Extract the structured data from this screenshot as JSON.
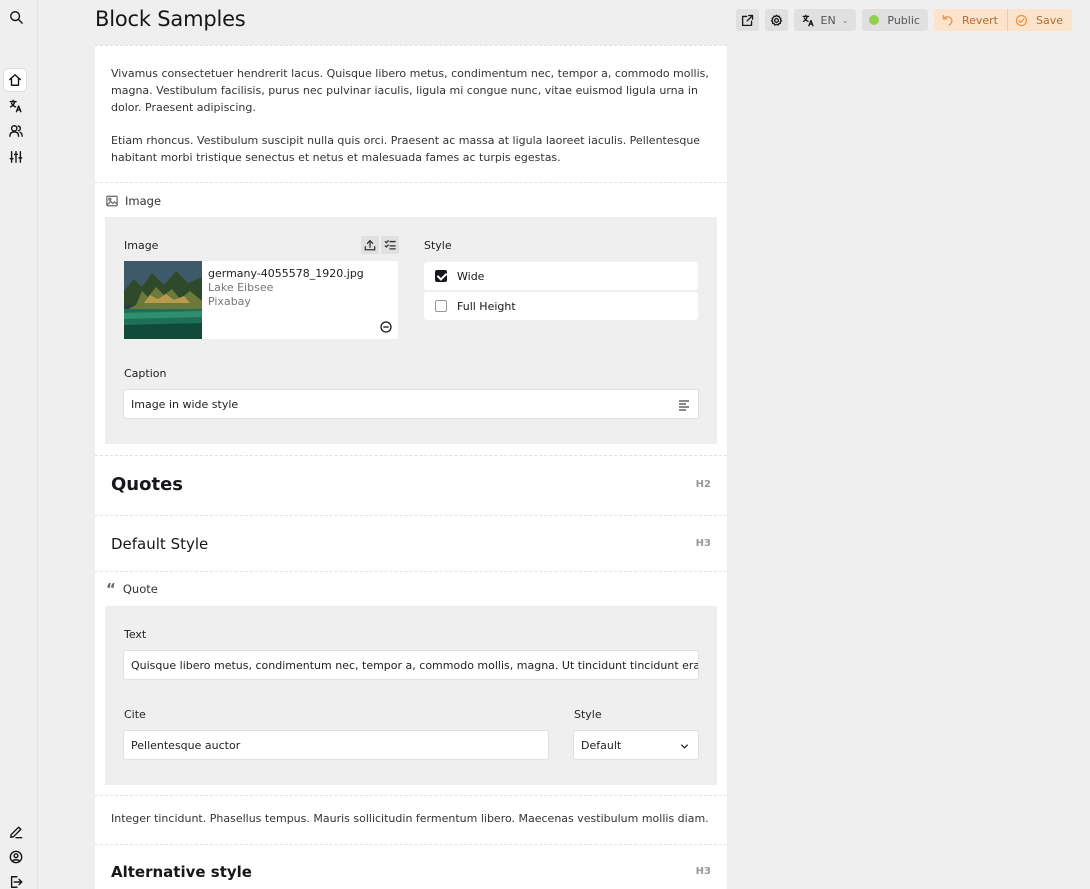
{
  "app": {
    "page_title": "Block Samples"
  },
  "toolbar": {
    "language": "EN",
    "status": "Public",
    "revert_label": "Revert",
    "save_label": "Save",
    "status_color": "#8fd14f",
    "accent_color": "#fce3cc"
  },
  "paragraphs": {
    "p1": "Vivamus consectetuer hendrerit lacus. Quisque libero metus, condimentum nec, tempor a, commodo mollis, magna. Vestibulum facilisis, purus nec pulvinar iaculis, ligula mi congue nunc, vitae euismod ligula urna in dolor. Praesent adipiscing.",
    "p2": "Etiam rhoncus. Vestibulum suscipit nulla quis orci. Praesent ac massa at ligula laoreet iaculis. Pellentesque habitant morbi tristique senectus et netus et malesuada fames ac turpis egestas.",
    "p3": "Integer tincidunt. Phasellus tempus. Mauris sollicitudin fermentum libero. Maecenas vestibulum mollis diam."
  },
  "image_block": {
    "block_label": "Image",
    "image_label": "Image",
    "file_name": "germany-4055578_1920.jpg",
    "alt_text": "Lake Eibsee",
    "credit": "Pixabay",
    "style_label": "Style",
    "style_options": [
      {
        "label": "Wide",
        "checked": true
      },
      {
        "label": "Full Height",
        "checked": false
      }
    ],
    "caption_label": "Caption",
    "caption_value": "Image in wide style"
  },
  "headings": {
    "quotes": {
      "text": "Quotes",
      "tag": "H2"
    },
    "default_style": {
      "text": "Default Style",
      "tag": "H3"
    },
    "alternative_style": {
      "text": "Alternative style",
      "tag": "H3"
    }
  },
  "quote_block": {
    "block_label": "Quote",
    "text_label": "Text",
    "text_value": "Quisque libero metus, condimentum nec, tempor a, commodo mollis, magna. Ut tincidunt tincidunt erat. Etiam iac",
    "cite_label": "Cite",
    "cite_value": "Pellentesque auctor",
    "style_label": "Style",
    "style_value": "Default"
  },
  "icons": [
    "search-icon",
    "home-icon",
    "translate-icon",
    "users-icon",
    "sliders-icon",
    "edit-icon",
    "account-icon",
    "logout-icon",
    "open-external-icon",
    "settings-icon",
    "revert-icon",
    "save-icon"
  ]
}
